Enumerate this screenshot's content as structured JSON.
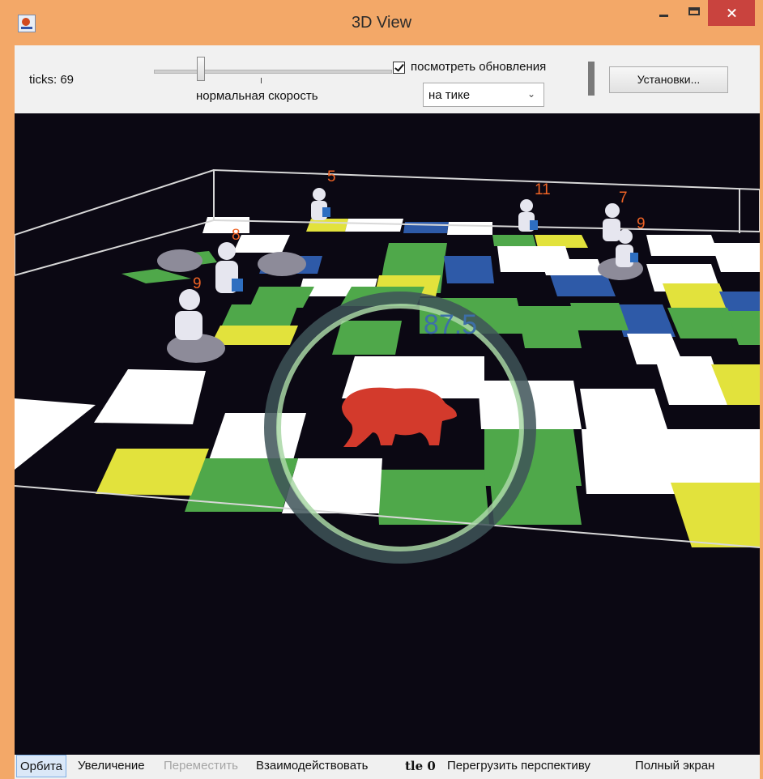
{
  "window": {
    "title": "3D View"
  },
  "controls": {
    "ticks_label": "ticks: 69",
    "speed_label": "нормальная скорость",
    "speed_value": 0.2,
    "view_updates_label": "посмотреть обновления",
    "view_updates_checked": true,
    "update_mode": "на тике",
    "settings_label": "Установки..."
  },
  "scene": {
    "center_score": "87.5",
    "bear_color": "#d33a2c",
    "tile_colors": {
      "green": "#4fa84a",
      "yellow": "#e2e23c",
      "blue": "#2e5aa8",
      "white": "#ffffff",
      "black": "#0b0813"
    },
    "agents": [
      {
        "label": "5"
      },
      {
        "label": "11"
      },
      {
        "label": "7"
      },
      {
        "label": "9"
      },
      {
        "label": "8"
      },
      {
        "label": "9"
      }
    ]
  },
  "status_bar": {
    "orbit": "Орбита",
    "zoom": "Увеличение",
    "move": "Переместить",
    "interact": "Взаимодействовать",
    "tle": "tle 0",
    "reset": "Перегрузить перспективу",
    "fullscreen": "Полный экран"
  }
}
